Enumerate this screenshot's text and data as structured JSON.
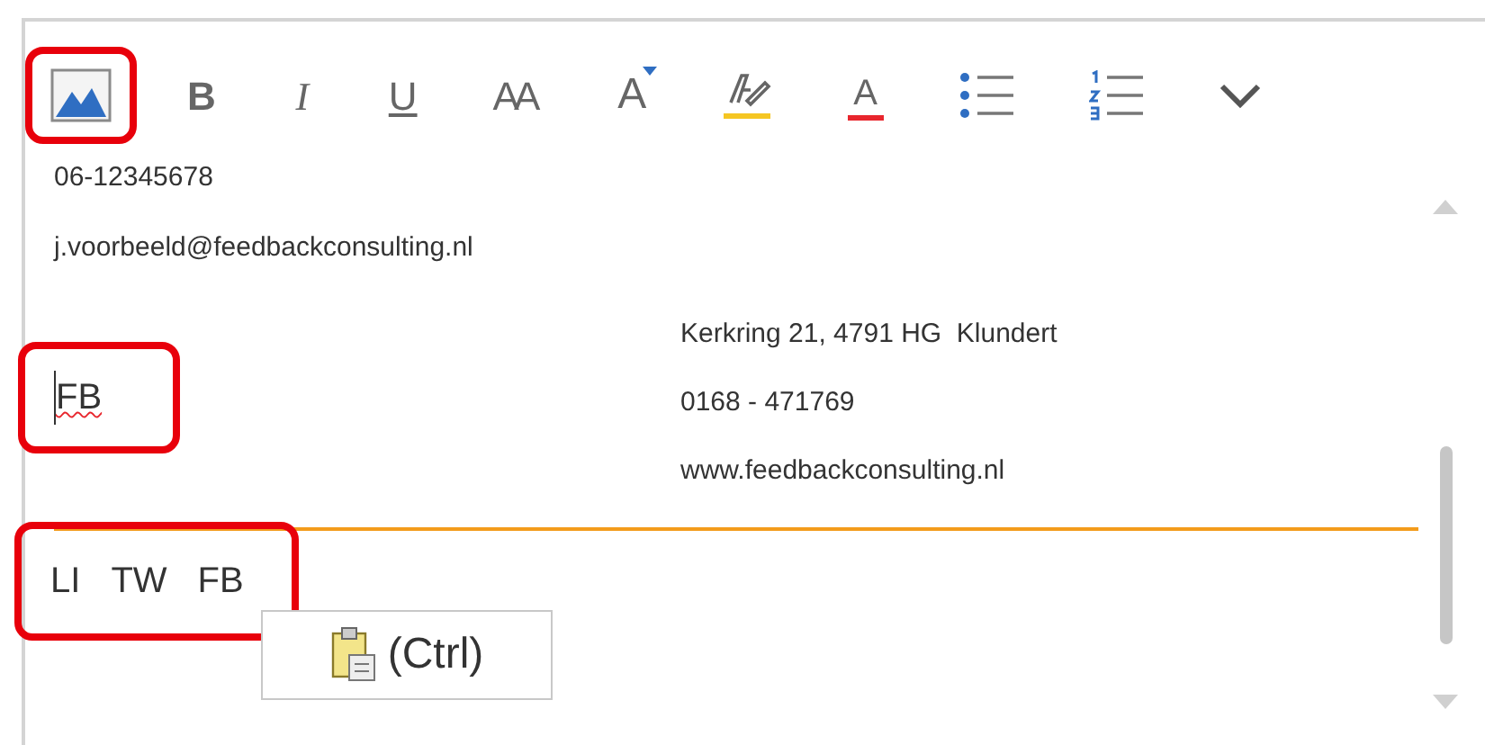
{
  "toolbar": [
    {
      "kind": "image",
      "highlighted": true
    },
    {
      "kind": "bold",
      "label": "B",
      "highlighted": false
    },
    {
      "kind": "italic",
      "label": "I",
      "highlighted": false
    },
    {
      "kind": "underline",
      "label": "U",
      "highlighted": false
    },
    {
      "kind": "font-size",
      "label": "AA",
      "highlighted": false
    },
    {
      "kind": "grow-font",
      "label": "A",
      "highlighted": false
    },
    {
      "kind": "highlighter",
      "highlighted": false
    },
    {
      "kind": "font-color",
      "label": "A",
      "highlighted": false
    },
    {
      "kind": "bullets",
      "highlighted": false
    },
    {
      "kind": "numbering",
      "highlighted": false
    },
    {
      "kind": "more",
      "highlighted": false
    }
  ],
  "contact": {
    "phone": "06-12345678",
    "email": "j.voorbeeld@feedbackconsulting.nl"
  },
  "logo_line": {
    "text": "FB",
    "misspelled": true,
    "highlighted": true
  },
  "address": [
    "Kerkring 21, 4791 HG  Klundert",
    "0168 - 471769",
    "www.feedbackconsulting.nl"
  ],
  "social": {
    "items": [
      "LI",
      "TW",
      "FB"
    ],
    "highlighted": true
  },
  "paste_options": {
    "label": "(Ctrl)"
  }
}
